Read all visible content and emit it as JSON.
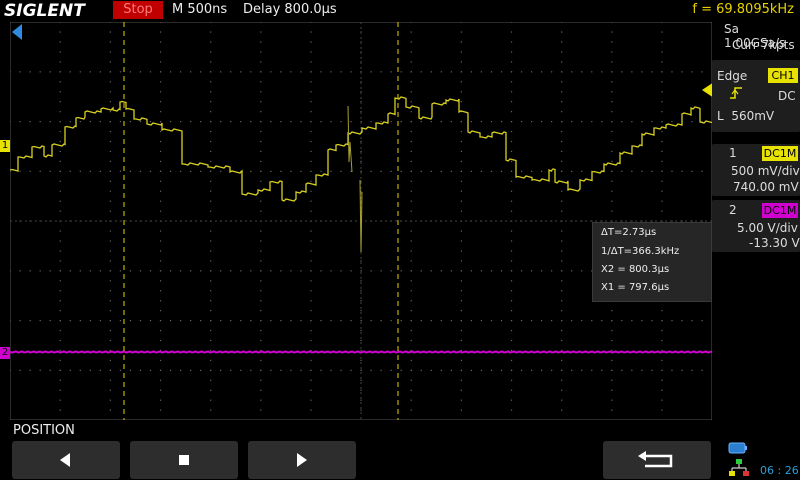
{
  "header": {
    "brand": "SIGLENT",
    "run_state": "Stop",
    "timebase": "M 500ns",
    "delay": "Delay 800.0μs",
    "frequency": "f = 69.8095kHz"
  },
  "acquisition": {
    "sample_rate": "Sa 1.00GSa/s",
    "memory": "Curr 7kpts"
  },
  "trigger": {
    "mode": "Edge",
    "source": "CH1",
    "coupling": "DC",
    "level": "L  560mV"
  },
  "channel1": {
    "number": "1",
    "coupling": "DC1M",
    "scale": "500 mV/div",
    "offset": "740.00 mV",
    "color": "#e8e200"
  },
  "channel2": {
    "number": "2",
    "coupling": "DC1M",
    "scale": "5.00 V/div",
    "offset": "-13.30 V",
    "color": "#d000d0"
  },
  "cursors": {
    "delta_t": "ΔT=2.73μs",
    "inv_delta_t": "1/ΔT=366.3kHz",
    "x2": "X2 = 800.3μs",
    "x1": "X1 = 797.6μs"
  },
  "bottom": {
    "menu_title": "POSITION",
    "buttons": [
      "left-arrow-icon",
      "stop-square-icon",
      "right-arrow-icon",
      "return-icon"
    ],
    "clock": "06 : 26"
  },
  "markers": {
    "ch1": "1",
    "ch2": "2"
  }
}
